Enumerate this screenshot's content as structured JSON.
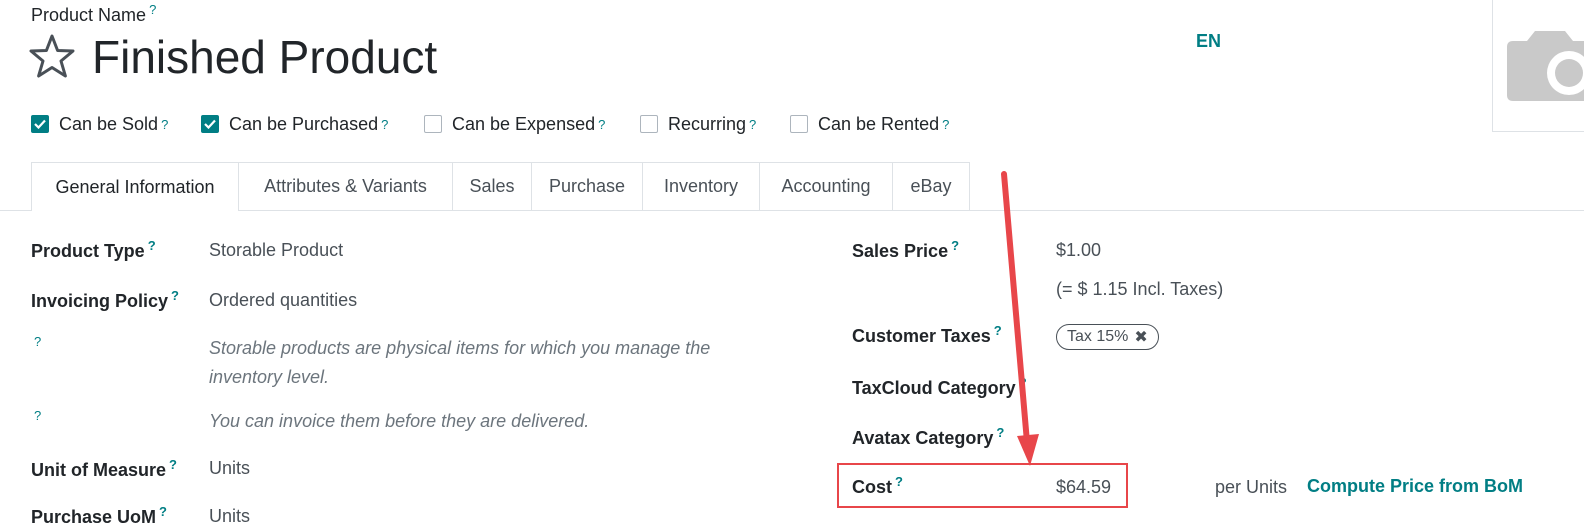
{
  "header": {
    "product_name_label": "Product Name",
    "help_mark": "?",
    "product_title": "Finished Product",
    "language": "EN",
    "image_placeholder_icon": "camera-icon"
  },
  "options": [
    {
      "label": "Can be Sold",
      "checked": true
    },
    {
      "label": "Can be Purchased",
      "checked": true
    },
    {
      "label": "Can be Expensed",
      "checked": false
    },
    {
      "label": "Recurring",
      "checked": false
    },
    {
      "label": "Can be Rented",
      "checked": false
    }
  ],
  "tabs": [
    {
      "label": "General Information",
      "active": true
    },
    {
      "label": "Attributes & Variants",
      "active": false
    },
    {
      "label": "Sales",
      "active": false
    },
    {
      "label": "Purchase",
      "active": false
    },
    {
      "label": "Inventory",
      "active": false
    },
    {
      "label": "Accounting",
      "active": false
    },
    {
      "label": "eBay",
      "active": false
    }
  ],
  "left_fields": {
    "product_type": {
      "label": "Product Type",
      "value": "Storable Product"
    },
    "invoicing_policy": {
      "label": "Invoicing Policy",
      "value": "Ordered quantities"
    },
    "hint_storable": "Storable products are physical items for which you manage the inventory level.",
    "hint_invoice": "You can invoice them before they are delivered.",
    "unit_of_measure": {
      "label": "Unit of Measure",
      "value": "Units"
    },
    "purchase_uom": {
      "label": "Purchase UoM",
      "value": "Units"
    }
  },
  "right_fields": {
    "sales_price": {
      "label": "Sales Price",
      "value": "$1.00",
      "incl_taxes": "(= $ 1.15 Incl. Taxes)"
    },
    "customer_taxes": {
      "label": "Customer Taxes",
      "tag": "Tax 15%"
    },
    "taxcloud_category": {
      "label": "TaxCloud Category"
    },
    "avatax_category": {
      "label": "Avatax Category"
    },
    "cost": {
      "label": "Cost",
      "value": "$64.59",
      "per_units": "per Units",
      "compute_link": "Compute Price from BoM"
    }
  },
  "colors": {
    "accent": "#017e84",
    "annotation": "#e8464a"
  }
}
